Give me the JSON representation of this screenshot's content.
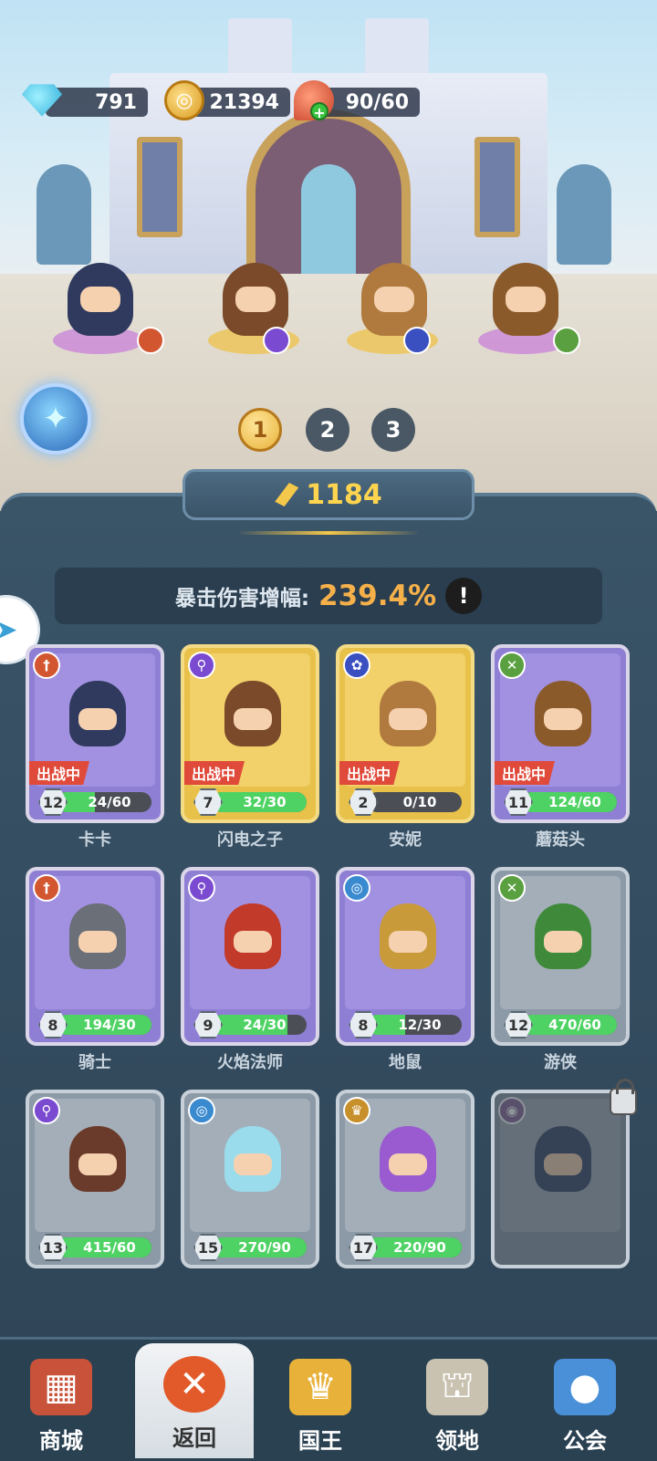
{
  "resources": {
    "gems": "791",
    "gold": "21394",
    "stamina": "90/60"
  },
  "team_pages": [
    "1",
    "2",
    "3"
  ],
  "active_page": "1",
  "power": "1184",
  "crit_bonus": {
    "label": "暴击伤害增幅:",
    "value": "239.4%",
    "info": "!"
  },
  "deployed_label": "出战中",
  "heroes": [
    {
      "name": "卡卡",
      "level": "12",
      "progress": "24/60",
      "fill": 0.4,
      "card": "purple",
      "class_color": "#d2562f",
      "class_icon": "dagger-icon",
      "deployed": true,
      "locked": false
    },
    {
      "name": "闪电之子",
      "level": "7",
      "progress": "32/30",
      "fill": 1.0,
      "card": "gold",
      "class_color": "#7a4ad0",
      "class_icon": "magnifier-icon",
      "deployed": true,
      "locked": false
    },
    {
      "name": "安妮",
      "level": "2",
      "progress": "0/10",
      "fill": 0.0,
      "card": "gold",
      "class_color": "#3a4fc0",
      "class_icon": "paw-icon",
      "deployed": true,
      "locked": false
    },
    {
      "name": "蘑菇头",
      "level": "11",
      "progress": "124/60",
      "fill": 1.0,
      "card": "purple",
      "class_color": "#5aa040",
      "class_icon": "crossbow-icon",
      "deployed": true,
      "locked": false
    },
    {
      "name": "骑士",
      "level": "8",
      "progress": "194/30",
      "fill": 1.0,
      "card": "purple",
      "class_color": "#d2562f",
      "class_icon": "dagger-icon",
      "deployed": false,
      "locked": false
    },
    {
      "name": "火焰法师",
      "level": "9",
      "progress": "24/30",
      "fill": 0.8,
      "card": "purple",
      "class_color": "#7a4ad0",
      "class_icon": "magnifier-icon",
      "deployed": false,
      "locked": false
    },
    {
      "name": "地鼠",
      "level": "8",
      "progress": "12/30",
      "fill": 0.4,
      "card": "purple",
      "class_color": "#3a8ad0",
      "class_icon": "spiral-icon",
      "deployed": false,
      "locked": false
    },
    {
      "name": "游侠",
      "level": "12",
      "progress": "470/60",
      "fill": 1.0,
      "card": "gray",
      "class_color": "#5aa040",
      "class_icon": "crossbow-icon",
      "deployed": false,
      "locked": false
    },
    {
      "name": "",
      "level": "13",
      "progress": "415/60",
      "fill": 1.0,
      "card": "gray",
      "class_color": "#7a4ad0",
      "class_icon": "magnifier-icon",
      "deployed": false,
      "locked": false
    },
    {
      "name": "",
      "level": "15",
      "progress": "270/90",
      "fill": 1.0,
      "card": "gray",
      "class_color": "#3a8ad0",
      "class_icon": "spiral-icon",
      "deployed": false,
      "locked": false
    },
    {
      "name": "",
      "level": "17",
      "progress": "220/90",
      "fill": 1.0,
      "card": "gray",
      "class_color": "#c8902a",
      "class_icon": "crown-icon",
      "deployed": false,
      "locked": false
    },
    {
      "name": "",
      "level": "",
      "progress": "",
      "fill": 0.0,
      "card": "gray",
      "class_color": "#8a6a9a",
      "class_icon": "eye-icon",
      "deployed": false,
      "locked": true
    }
  ],
  "field_heroes": [
    {
      "name": "卡卡",
      "color": "#2f3a5e",
      "ring": "#c77bd8",
      "class_color": "#d2562f"
    },
    {
      "name": "闪电之子",
      "color": "#7a4a2a",
      "ring": "#f0c040",
      "class_color": "#7a4ad0"
    },
    {
      "name": "安妮",
      "color": "#b07a3e",
      "ring": "#f0c040",
      "class_color": "#3a4fc0"
    },
    {
      "name": "蘑菇头",
      "color": "#8a5a2a",
      "ring": "#c77bd8",
      "class_color": "#5aa040"
    }
  ],
  "nav": [
    {
      "label": "商城",
      "icon": "shop-icon",
      "active": false
    },
    {
      "label": "返回",
      "icon": "close-icon",
      "active": true
    },
    {
      "label": "国王",
      "icon": "crown-icon",
      "active": false
    },
    {
      "label": "领地",
      "icon": "castle-icon",
      "active": false
    },
    {
      "label": "公会",
      "icon": "planet-icon",
      "active": false
    }
  ],
  "colors": {
    "accent_gold": "#f6b04a",
    "progress_green": "#4fd264",
    "deployed_red": "#e04a3a"
  }
}
